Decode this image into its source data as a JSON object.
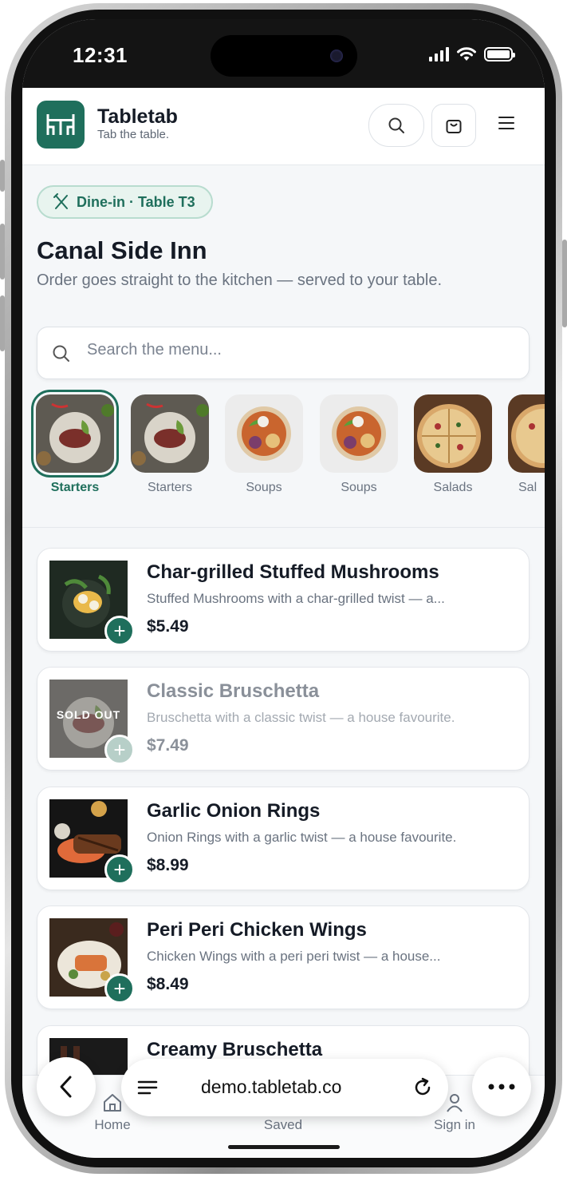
{
  "status_bar": {
    "time": "12:31"
  },
  "header": {
    "brand_name": "Tabletab",
    "tagline": "Tab the table."
  },
  "dining_chip": "Dine-in · Table T3",
  "restaurant": {
    "name": "Canal Side Inn",
    "subtitle": "Order goes straight to the kitchen — served to your table."
  },
  "search": {
    "placeholder": "Search the menu..."
  },
  "categories": [
    {
      "label": "Starters",
      "active": true
    },
    {
      "label": "Starters",
      "active": false
    },
    {
      "label": "Soups",
      "active": false
    },
    {
      "label": "Soups",
      "active": false
    },
    {
      "label": "Salads",
      "active": false
    },
    {
      "label": "Sal",
      "active": false
    }
  ],
  "menu_items": [
    {
      "name": "Char-grilled Stuffed Mushrooms",
      "description": "Stuffed Mushrooms with a char-grilled twist — a...",
      "price": "$5.49",
      "sold_out": false
    },
    {
      "name": "Classic Bruschetta",
      "description": "Bruschetta with a classic twist — a house favourite.",
      "price": "$7.49",
      "sold_out": true,
      "badge": "SOLD OUT"
    },
    {
      "name": "Garlic Onion Rings",
      "description": "Onion Rings with a garlic twist — a house favourite.",
      "price": "$8.99",
      "sold_out": false
    },
    {
      "name": "Peri Peri Chicken Wings",
      "description": "Chicken Wings with a peri peri twist — a house...",
      "price": "$8.49",
      "sold_out": false
    },
    {
      "name": "Creamy Bruschetta",
      "description": "",
      "price": "",
      "sold_out": false
    }
  ],
  "bottom_nav": {
    "home": "Home",
    "saved": "Saved",
    "sign_in": "Sign in"
  },
  "browser": {
    "url": "demo.tabletab.co"
  },
  "colors": {
    "accent": "#1f6f5c",
    "chip_bg": "#e8f4ef",
    "text": "#151b26",
    "muted": "#6a7380"
  }
}
